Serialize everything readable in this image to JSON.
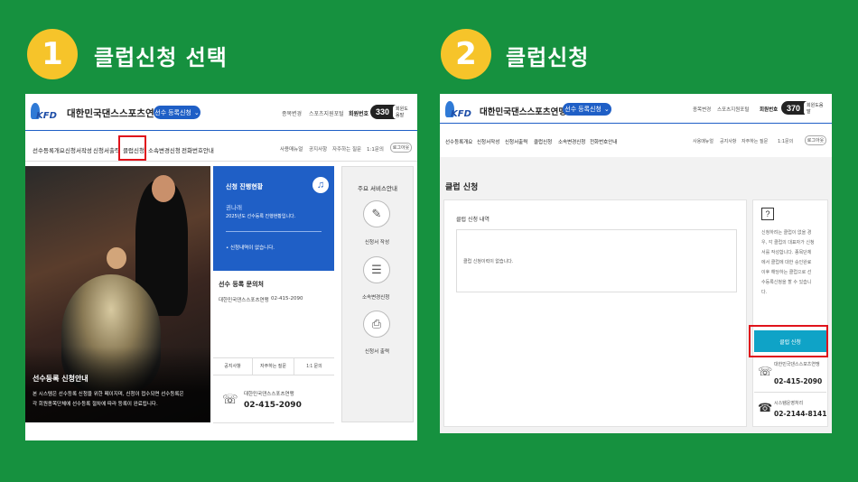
{
  "steps": [
    {
      "number": "1",
      "title": "클럽신청 선택"
    },
    {
      "number": "2",
      "title": "클럽신청"
    }
  ],
  "colors": {
    "background": "#16913f",
    "badge": "#f6c42a",
    "accent_blue": "#1f5fc6",
    "highlight_red": "#e0131b",
    "teal_button": "#0fa3c7"
  },
  "left": {
    "org_name": "대한민국댄스스포츠연맹",
    "logo_text": "KFD",
    "menu_pill": "선수 등록신청",
    "top_links": [
      "종목변경",
      "스포츠지원포털"
    ],
    "visit_label": "회원번호",
    "visit_count": "330",
    "visit_sub": "회원도움말",
    "nav": [
      "선수등록개요",
      "신청서작성",
      "신청서출력",
      "클럽신청",
      "소속변경신청",
      "전화번호안내"
    ],
    "util_links": [
      "사용매뉴얼",
      "공지사항",
      "자주하는 질문",
      "1:1문의"
    ],
    "logout": "로그아웃",
    "status_box": {
      "title": "신청 진행현황",
      "name": "권나래",
      "line": "2025년도 선수등록 진행현황입니다.",
      "empty": "• 신청내역이 없습니다."
    },
    "inquiry": {
      "title": "선수 등록 문의처",
      "org": "대한민국댄스스포츠연맹",
      "phone": "02-415-2090"
    },
    "bottom_tabs": [
      "공지사항",
      "자주하는 질문",
      "1:1 문의"
    ],
    "contact": {
      "org": "대한민국댄스스포츠연맹",
      "phone": "02-415-2090"
    },
    "services": {
      "title": "주요 서비스안내",
      "items": [
        "신청서 작성",
        "소속변경신청",
        "신청서 출력"
      ]
    },
    "hero": {
      "title": "선수등록 신청안내",
      "line1": "본 시스템은 선수등록 신청을 위한 페이지며, 신청이 접수되면 선수등록은",
      "line2": "각 회원종목단체에 선수등록 절차에 따라 등록이 완료됩니다."
    }
  },
  "right": {
    "org_name": "대한민국댄스스포츠연맹",
    "logo_text": "KFD",
    "menu_pill": "선수 등록신청",
    "top_links": [
      "종목변경",
      "스포츠지원포털"
    ],
    "visit_label": "회원번호",
    "visit_count": "370",
    "visit_sub": "회원도움말",
    "nav": [
      "선수등록개요",
      "신청서작성",
      "신청서출력",
      "클럽신청",
      "소속변경신청",
      "전화번호안내"
    ],
    "util_links": [
      "사용매뉴얼",
      "공지사항",
      "자주하는 질문",
      "1:1문의"
    ],
    "logout": "로그아웃",
    "page_title": "클럽 신청",
    "history_title": "클럽 신청 내역",
    "history_empty": "클럽 신청이력이 없습니다.",
    "help_text": [
      "신청하려는 클럽이 없을 경",
      "우, 각 클럽의 대표자가 신청",
      "서를 작성합니다. 종목단체",
      "에서 클럽에 대한 승인완료",
      "이후 해당하는 클럽으로 선",
      "수등록신청을 할 수 있습니",
      "다."
    ],
    "apply_button": "클럽 신청",
    "contact1": {
      "org": "대한민국댄스스포츠연맹",
      "phone": "02-415-2090"
    },
    "contact2": {
      "org": "시스템운영처리",
      "phone": "02-2144-8141"
    }
  }
}
